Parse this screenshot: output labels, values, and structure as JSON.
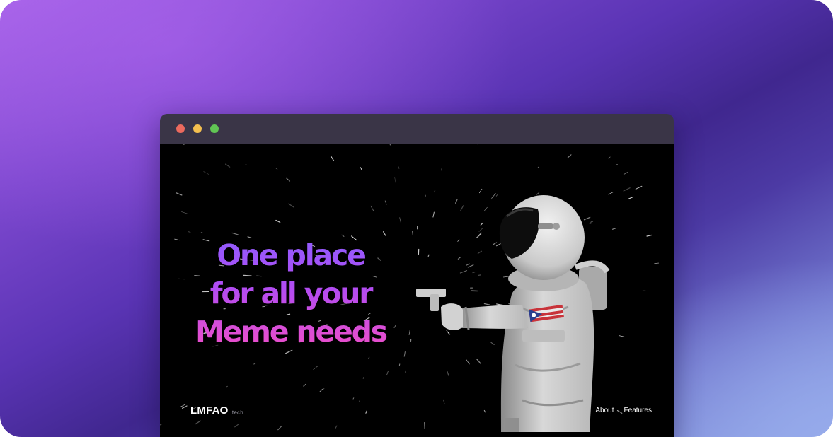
{
  "page": {
    "headline_lines": [
      "One place",
      "for all your",
      "Meme needs"
    ],
    "logo": {
      "name": "LMFAO",
      "tld": ".tech"
    },
    "nav": [
      {
        "label": "About"
      },
      {
        "label": "Features"
      }
    ],
    "hero_image": {
      "subject": "astronaut holding a pistol in space"
    }
  },
  "window": {
    "controls": [
      "close",
      "minimize",
      "zoom"
    ],
    "colors": {
      "close": "#ec6a5e",
      "minimize": "#f4bf4f",
      "zoom": "#61c554"
    }
  },
  "theme": {
    "gradient_start": "#8f5cff",
    "gradient_mid": "#b24cf2",
    "gradient_end": "#ee4fc8",
    "page_background": "#000000",
    "titlebar": "#3a3547"
  }
}
